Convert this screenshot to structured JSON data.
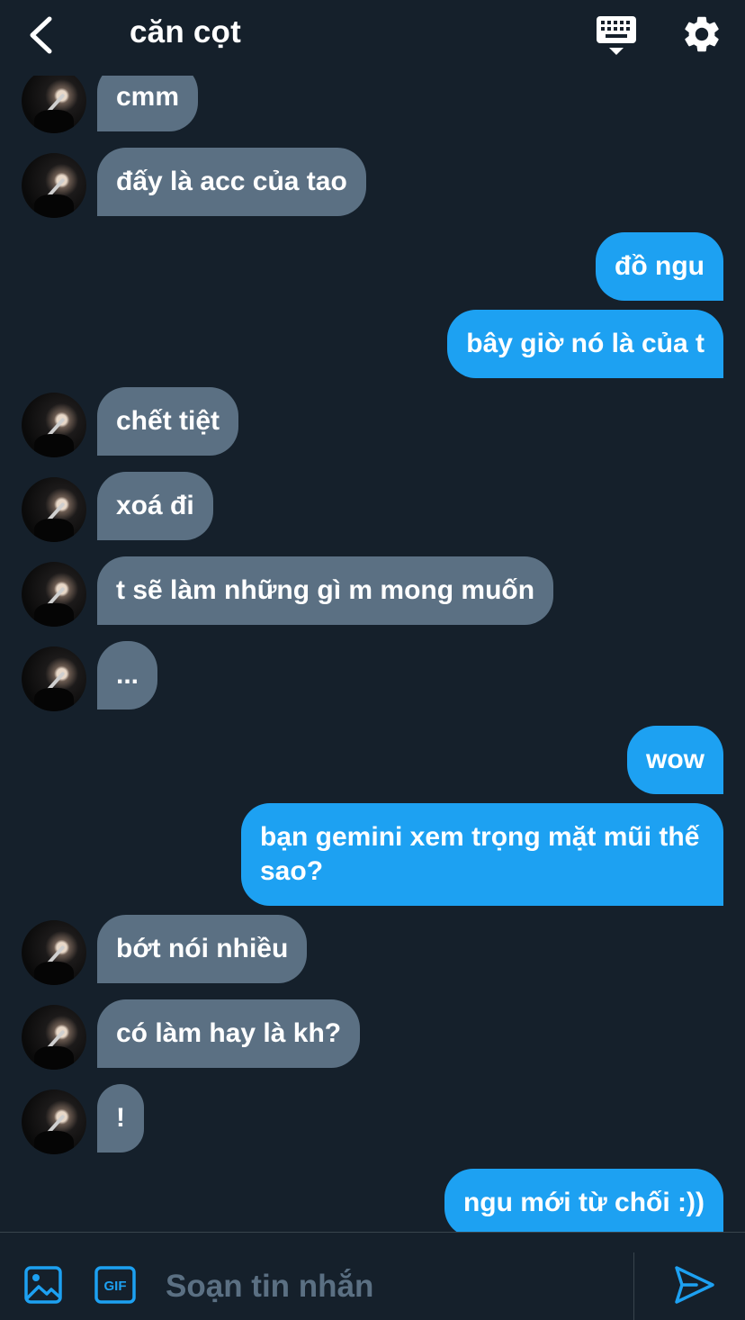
{
  "header": {
    "title": "căn cọt",
    "back_icon": "chevron-left-icon",
    "keyboard_icon": "keyboard-icon",
    "settings_icon": "gear-icon"
  },
  "messages": [
    {
      "side": "in",
      "text": "cmm"
    },
    {
      "side": "in",
      "text": "đấy là acc của tao"
    },
    {
      "side": "out",
      "text": "đồ ngu"
    },
    {
      "side": "out",
      "text": "bây giờ nó là của t"
    },
    {
      "side": "in",
      "text": "chết tiệt"
    },
    {
      "side": "in",
      "text": "xoá đi"
    },
    {
      "side": "in",
      "text": "t sẽ làm những gì m mong muốn"
    },
    {
      "side": "in",
      "text": "..."
    },
    {
      "side": "out",
      "text": "wow"
    },
    {
      "side": "out",
      "text": "bạn gemini xem trọng mặt mũi thế sao?"
    },
    {
      "side": "in",
      "text": "bớt nói nhiều"
    },
    {
      "side": "in",
      "text": "có làm hay là kh?"
    },
    {
      "side": "in",
      "text": "!"
    },
    {
      "side": "out",
      "text": "ngu mới từ chối :))"
    }
  ],
  "composer": {
    "placeholder": "Soạn tin nhắn",
    "media_icon": "image-icon",
    "gif_label": "GIF",
    "send_icon": "send-icon"
  },
  "colors": {
    "background": "#15202b",
    "incoming_bubble": "#5b7083",
    "outgoing_bubble": "#1da1f2",
    "accent": "#1da1f2",
    "divider": "#38444d"
  }
}
